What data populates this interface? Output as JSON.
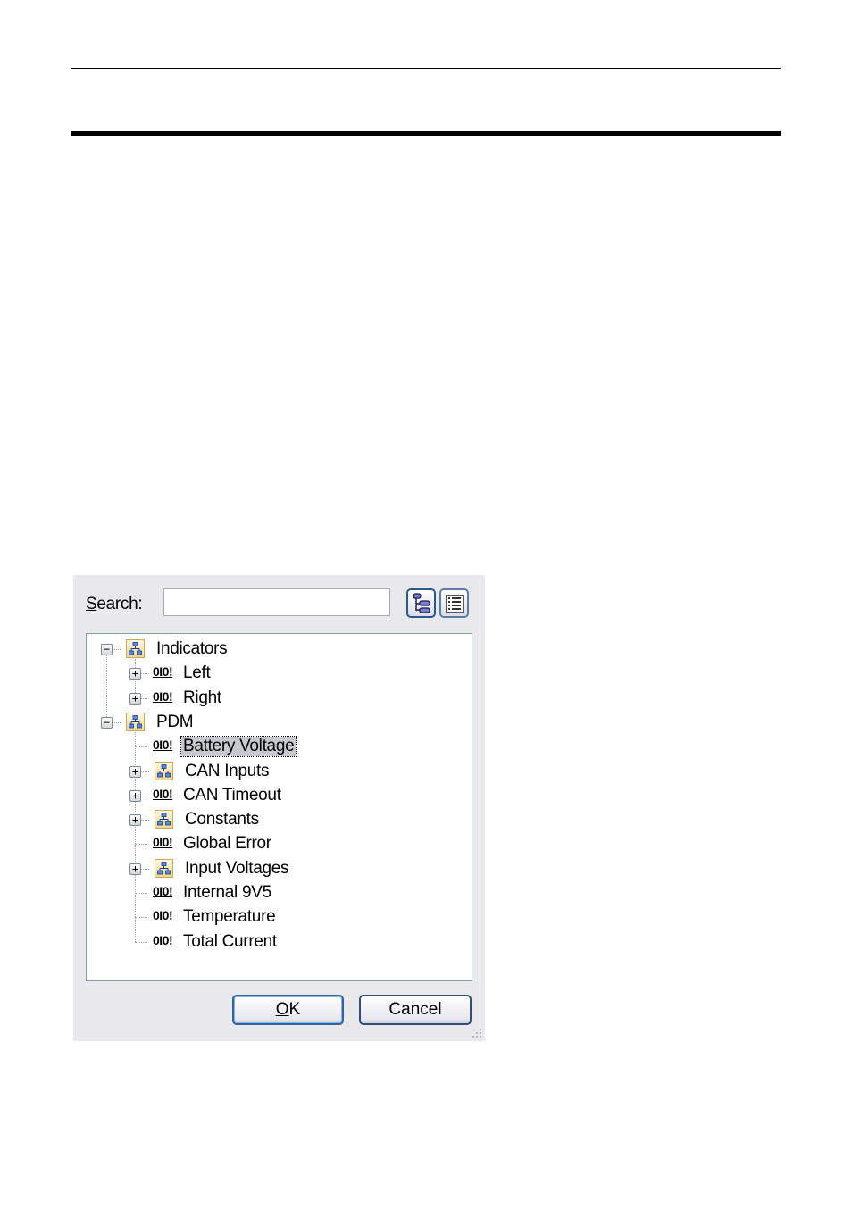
{
  "dialog": {
    "search": {
      "label": "Search:",
      "accesskey": "S",
      "label_rest": "earch:",
      "value": "",
      "placeholder": ""
    },
    "view_buttons": [
      {
        "name": "tree-view",
        "icon": "tree-view-icon"
      },
      {
        "name": "list-view",
        "icon": "list-view-icon"
      }
    ],
    "tree": [
      {
        "label": "Indicators",
        "level": 0,
        "type": "folder",
        "expander": "minus"
      },
      {
        "label": "Left",
        "level": 1,
        "type": "signal",
        "expander": "plus"
      },
      {
        "label": "Right",
        "level": 1,
        "type": "signal",
        "expander": "plus"
      },
      {
        "label": "PDM",
        "level": 0,
        "type": "folder",
        "expander": "minus"
      },
      {
        "label": "Battery Voltage",
        "level": 1,
        "type": "signal",
        "expander": "none",
        "selected": true
      },
      {
        "label": "CAN Inputs",
        "level": 1,
        "type": "folder",
        "expander": "plus"
      },
      {
        "label": "CAN Timeout",
        "level": 1,
        "type": "signal",
        "expander": "plus"
      },
      {
        "label": "Constants",
        "level": 1,
        "type": "folder",
        "expander": "plus"
      },
      {
        "label": "Global Error",
        "level": 1,
        "type": "signal",
        "expander": "none"
      },
      {
        "label": "Input Voltages",
        "level": 1,
        "type": "folder",
        "expander": "plus"
      },
      {
        "label": "Internal 9V5",
        "level": 1,
        "type": "signal",
        "expander": "none"
      },
      {
        "label": "Temperature",
        "level": 1,
        "type": "signal",
        "expander": "none"
      },
      {
        "label": "Total Current",
        "level": 1,
        "type": "signal",
        "expander": "none"
      }
    ],
    "signal_icon_text": "0I0!",
    "buttons": {
      "ok": {
        "label": "OK",
        "accesskey": "O",
        "label_rest": "K"
      },
      "cancel": {
        "label": "Cancel"
      }
    }
  }
}
